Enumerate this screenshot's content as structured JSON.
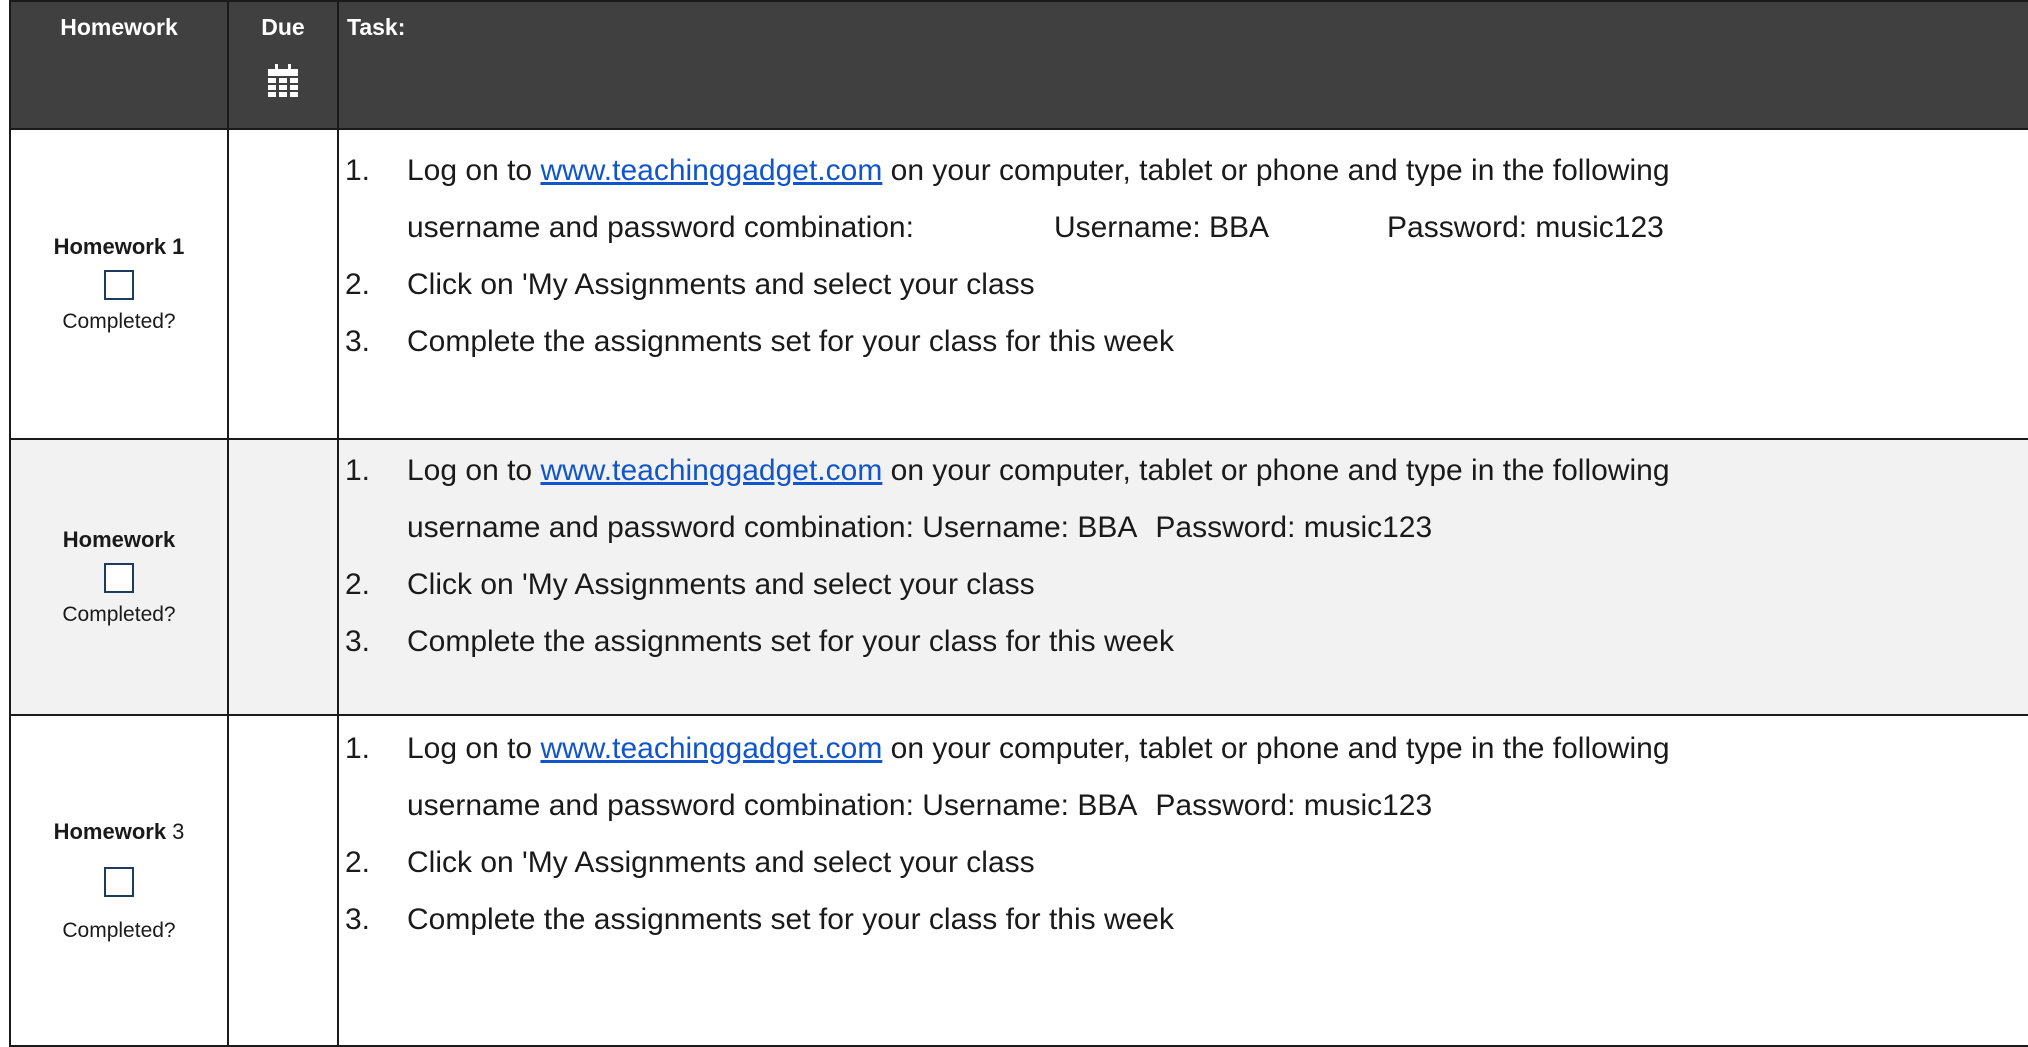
{
  "header": {
    "homework": "Homework",
    "due": "Due",
    "task": "Task:",
    "due_icon": "calendar-icon"
  },
  "rows": [
    {
      "title": "Homework 1",
      "number": "",
      "completed": "Completed?",
      "steps": [
        {
          "num": "1.",
          "pre": "Log on to ",
          "link": "www.teachinggadget.com",
          "post": " on your computer, tablet or phone and type in the following"
        },
        {
          "num": "",
          "text": "username and password combination:",
          "username": "Username: BBA",
          "password": "Password: music123"
        },
        {
          "num": "2.",
          "text": "Click on 'My Assignments and select your class"
        },
        {
          "num": "3.",
          "text": "Complete the assignments set for your class for this week"
        }
      ]
    },
    {
      "title": "Homework",
      "number": "",
      "completed": "Completed?",
      "steps": [
        {
          "num": "1.",
          "pre": "Log on to ",
          "link": "www.teachinggadget.com",
          "post": " on your computer, tablet or phone and type in the following"
        },
        {
          "num": "",
          "text": "username and password combination: Username: BBA",
          "password": "Password: music123"
        },
        {
          "num": "2.",
          "text": "Click on 'My Assignments and select your class"
        },
        {
          "num": "3.",
          "text": "Complete the assignments set for your class for this week"
        }
      ]
    },
    {
      "title": "Homework",
      "number": " 3",
      "completed": "Completed?",
      "steps": [
        {
          "num": "1.",
          "pre": "Log on to ",
          "link": "www.teachinggadget.com",
          "post": " on your computer, tablet or phone and type in the following"
        },
        {
          "num": "",
          "text": "username and password combination: Username: BBA",
          "password": "Password: music123"
        },
        {
          "num": "2.",
          "text": "Click on 'My Assignments and select your class"
        },
        {
          "num": "3.",
          "text": "Complete the assignments set for your class for this week"
        }
      ]
    }
  ]
}
